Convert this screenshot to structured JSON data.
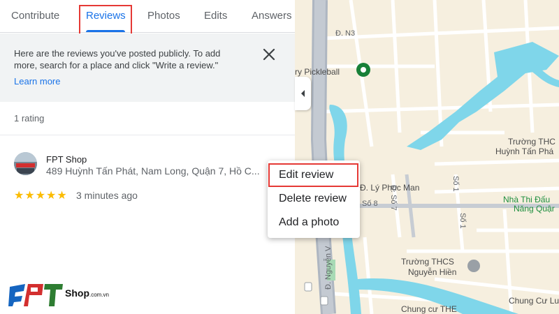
{
  "tabs": [
    {
      "label": "Contribute"
    },
    {
      "label": "Reviews"
    },
    {
      "label": "Photos"
    },
    {
      "label": "Edits"
    },
    {
      "label": "Answers"
    }
  ],
  "active_tab": "Reviews",
  "notice": {
    "text": "Here are the reviews you've posted publicly. To add more, search for a place and click \"Write a review.\"",
    "link": "Learn more"
  },
  "rating_count": "1 rating",
  "review": {
    "place_name": "FPT Shop",
    "address": "489 Huỳnh Tấn Phát, Nam Long, Quận 7, Hồ C...",
    "stars": "★★★★★",
    "rating": 5,
    "time": "3 minutes ago"
  },
  "context_menu": {
    "items": [
      {
        "label": "Edit review"
      },
      {
        "label": "Delete review"
      },
      {
        "label": "Add a photo"
      }
    ]
  },
  "map": {
    "labels": {
      "n3": "Đ. N3",
      "pickleball": "ry Pickleball",
      "ly_phuc_man": "Đ. Lý Phục Man",
      "so7": "Đ. Số 7",
      "so8": "Số 8",
      "so1a": "Số 1",
      "so1b": "Số 1",
      "nguyen": "Đ. Nguyễn V",
      "truong1": "Trường THC",
      "truong1b": "Huỳnh Tấn Phá",
      "nha_thi_dau": "Nhà Thi Đấu",
      "nha_thi_dau2": "Năng Quậr",
      "thcs": "Trường THCS",
      "thcs2": "Nguyễn Hiền",
      "chung_cu": "Chung cư THE",
      "chung_cu2": "Chung Cư Lu"
    },
    "colors": {
      "land": "#f6efdf",
      "water": "#7fd6ea",
      "road": "#ffffff",
      "highway": "#aeb6c1"
    }
  },
  "brand": {
    "logo_letters": "FPT",
    "shop": "Shop",
    "domain": ".com.vn"
  },
  "colors": {
    "accent": "#1a73e8",
    "highlight": "#e53935",
    "star": "#fbbc04"
  }
}
